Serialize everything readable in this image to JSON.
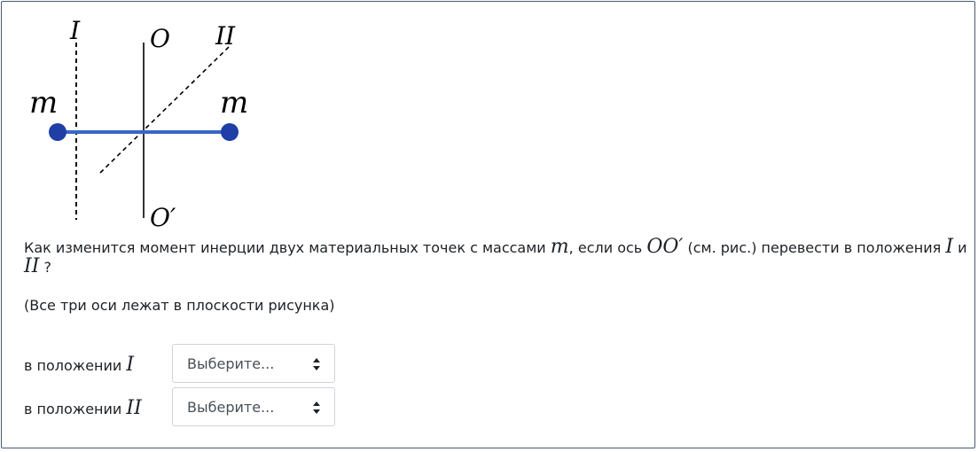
{
  "figure": {
    "labels": {
      "axis_I": "I",
      "axis_O": "O",
      "axis_II": "II",
      "axis_O_prime": "O′",
      "mass_left": "m",
      "mass_right": "m"
    },
    "colors": {
      "rod": "#3a67c6",
      "mass": "#1f3fa6",
      "axis": "#000000"
    }
  },
  "question": {
    "line_a": "Как изменится момент инерции двух материальных точек с массами",
    "var_m": "m",
    "line_b": ", если ось",
    "var_axis": "OO′",
    "line_c": "(см. рис.) перевести в положения",
    "var_I": "I",
    "conj": "и",
    "var_II": "II",
    "end": "?",
    "note": "(Все три оси лежат в плоскости рисунка)"
  },
  "answers": [
    {
      "prefix": "в положении",
      "var": "I",
      "select_value": "Выберите..."
    },
    {
      "prefix": "в положении",
      "var": "II",
      "select_value": "Выберите..."
    }
  ]
}
